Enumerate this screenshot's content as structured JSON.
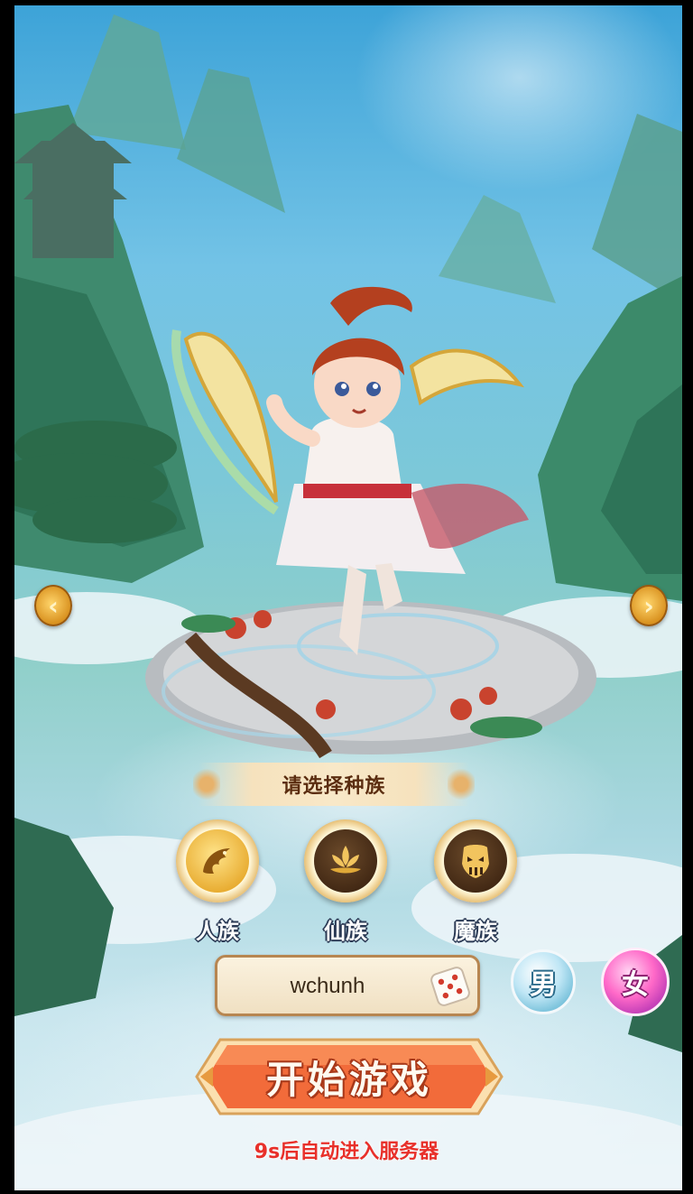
{
  "race_select": {
    "title": "请选择种族",
    "options": [
      {
        "label": "人族",
        "icon": "dragon-icon",
        "selected": true
      },
      {
        "label": "仙族",
        "icon": "lotus-icon",
        "selected": false
      },
      {
        "label": "魔族",
        "icon": "demon-mask-icon",
        "selected": false
      }
    ]
  },
  "nav": {
    "prev_icon": "chevron-left-icon",
    "next_icon": "chevron-right-icon"
  },
  "character": {
    "name_value": "wchunh",
    "random_name_icon": "dice-icon"
  },
  "gender": {
    "male_label": "男",
    "female_label": "女",
    "selected": "female"
  },
  "start": {
    "button_label": "开始游戏",
    "auto_enter_text": "9s后自动进入服务器"
  },
  "colors": {
    "start_button": "#f26b3a",
    "auto_enter_text": "#e8302a",
    "selected_race": "#e6a729",
    "female_selected": "#ff69c8"
  }
}
